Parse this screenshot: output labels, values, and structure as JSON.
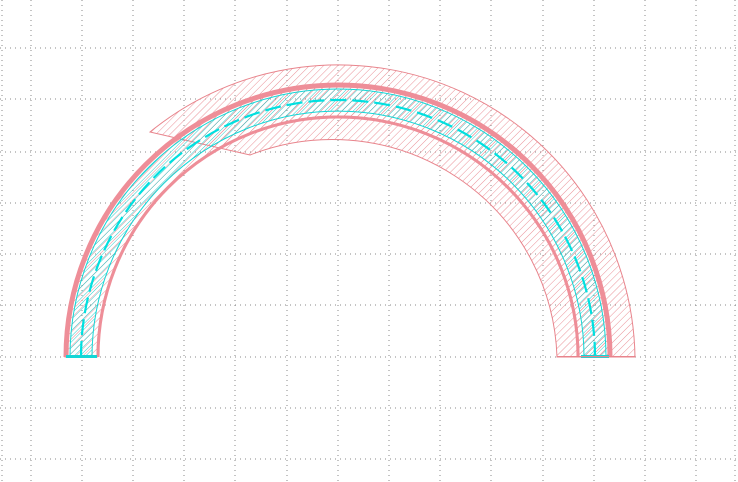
{
  "diagram": {
    "kind": "layout-view",
    "background_color": "#ffffff",
    "grid": {
      "visible": true,
      "style": "dotted",
      "color": "#8a8a8a"
    },
    "layers": [
      {
        "name": "pink-layer",
        "color": "#e8848c",
        "fill": "hatch"
      },
      {
        "name": "cyan-layer",
        "color": "#14d6d6",
        "fill": "hatch"
      }
    ],
    "shapes": [
      {
        "name": "outer-pink-arc-ring",
        "layer": "pink-layer",
        "outline_only": false
      },
      {
        "name": "inner-pink-band",
        "layer": "pink-layer",
        "outline_only": false
      },
      {
        "name": "cyan-waveguide-arc",
        "layer": "cyan-layer",
        "outline_only": false
      },
      {
        "name": "cyan-centerline-dashed",
        "layer": "cyan-layer",
        "outline_only": true
      }
    ]
  }
}
